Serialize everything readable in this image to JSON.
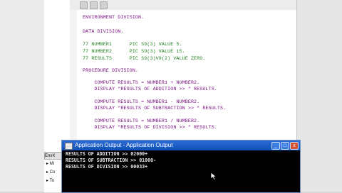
{
  "editor": {
    "lines": [
      {
        "text": "ENVIRONMENT DIVISION.",
        "style": "purple"
      },
      {
        "text": "DATA DIVISION.",
        "style": "purple"
      },
      {
        "text": "77 NUMBER1      PIC S9(3) VALUE 5.",
        "style": "green"
      },
      {
        "text": "77 NUMBER2      PIC S9(3) VALUE 15.",
        "style": "green"
      },
      {
        "text": "77 RESULTS      PIC S9(3)V9(2) VALUE ZERO.",
        "style": "green"
      },
      {
        "text": "PROCEDURE DIVISION.",
        "style": "purple"
      },
      {
        "text": "    COMPUTE RESULTS = NUMBER1 + NUMBER2.",
        "style": "purple"
      },
      {
        "text": "    DISPLAY \"RESULTS OF ADDITION >> \" RESULTS.",
        "style": "purple"
      },
      {
        "text": "    COMPUTE RESULTS = NUMBER1 - NUMBER2.",
        "style": "purple"
      },
      {
        "text": "    DISPLAY \"RESULTS OF SUBTRACTION >> \" RESULTS.",
        "style": "purple"
      },
      {
        "text": "    COMPUTE RESULTS = NUMBER1 / NUMBER2.",
        "style": "purple"
      },
      {
        "text": "    DISPLAY \"RESULTS OF DIVISION >> \" RESULTS.",
        "style": "purple"
      }
    ]
  },
  "output_window": {
    "title": "Application Output - Application Output",
    "minimize_label": "_",
    "restore_label": "□",
    "close_label": "x",
    "lines": [
      "RESULTS OF ADDITION >> 02000+",
      "RESULTS OF SUBTRACTION >> 01000-",
      "RESULTS OF DIVISION >> 00033+"
    ]
  },
  "tree": {
    "tab_label": "EnvX",
    "items": [
      "Mi",
      "Co",
      "To"
    ]
  },
  "colors": {
    "keyword": "#7a0f82",
    "data_decl": "#1e7f1e",
    "console_bg": "#000000",
    "title_bar": "#0e4fb8"
  }
}
